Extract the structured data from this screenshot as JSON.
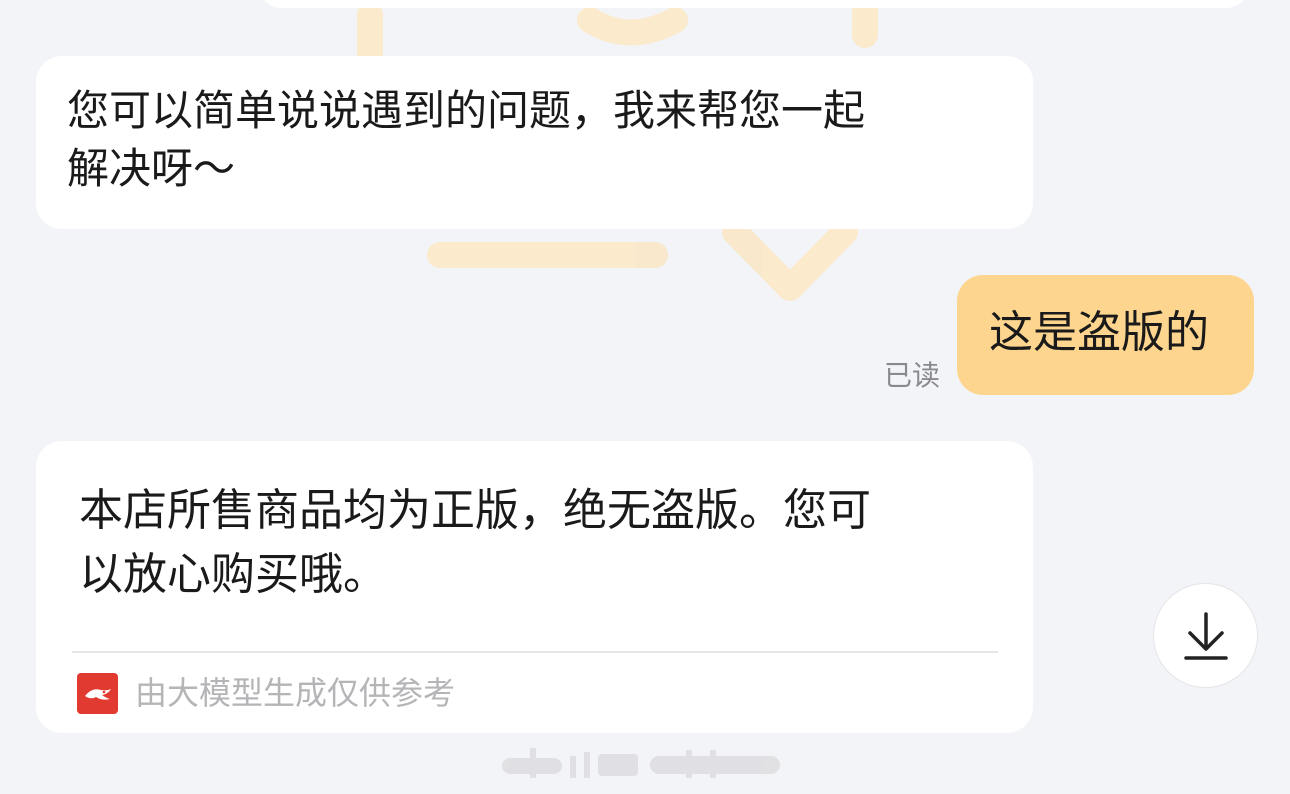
{
  "messages": [
    {
      "side": "left",
      "lines": [
        "您可以简单说说遇到的问题，我来帮您一起",
        "解决呀～"
      ]
    },
    {
      "side": "right",
      "text": "这是盗版的",
      "status": "已读"
    },
    {
      "side": "left",
      "lines": [
        "本店所售商品均为正版，绝无盗版。您可",
        "以放心购买哦。"
      ],
      "footer": "由大模型生成仅供参考"
    }
  ],
  "icons": {
    "download": "arrow-down-to-line-icon",
    "ai_logo": "bird-logo-icon"
  },
  "colors": {
    "background": "#f3f4f8",
    "incoming_bubble": "#ffffff",
    "outgoing_bubble": "#fdd58e",
    "logo": "#e13a30",
    "muted_text": "#b5b5b8"
  }
}
